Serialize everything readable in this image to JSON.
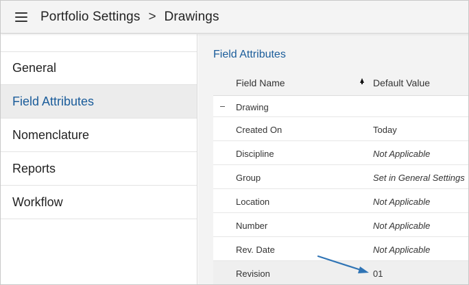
{
  "header": {
    "breadcrumb": [
      "Portfolio Settings",
      "Drawings"
    ],
    "separator": ">",
    "menu_icon": "hamburger-menu-icon"
  },
  "sidebar": {
    "items": [
      {
        "label": "General"
      },
      {
        "label": "Field Attributes",
        "active": true
      },
      {
        "label": "Nomenclature"
      },
      {
        "label": "Reports"
      },
      {
        "label": "Workflow"
      }
    ]
  },
  "main": {
    "section_title": "Field Attributes",
    "columns": {
      "name": "Field Name",
      "default": "Default Value",
      "sort_icon": "sort-ascending-icon"
    },
    "group": {
      "label": "Drawing",
      "toggle_icon": "collapse-minus-icon",
      "toggle_glyph": "–"
    },
    "rows": [
      {
        "name": "Created On",
        "value": "Today"
      },
      {
        "name": "Discipline",
        "value": "Not Applicable"
      },
      {
        "name": "Group",
        "value": "Set in General Settings"
      },
      {
        "name": "Location",
        "value": "Not Applicable"
      },
      {
        "name": "Number",
        "value": "Not Applicable"
      },
      {
        "name": "Rev. Date",
        "value": "Not Applicable"
      },
      {
        "name": "Revision",
        "value": "01"
      }
    ]
  },
  "annotation": {
    "arrow_color": "#2f74b5",
    "icon": "callout-arrow-icon"
  },
  "colors": {
    "accent": "#1a5c9a",
    "header_bg": "#f4f4f4",
    "panel_bg": "#f3f3f3"
  }
}
